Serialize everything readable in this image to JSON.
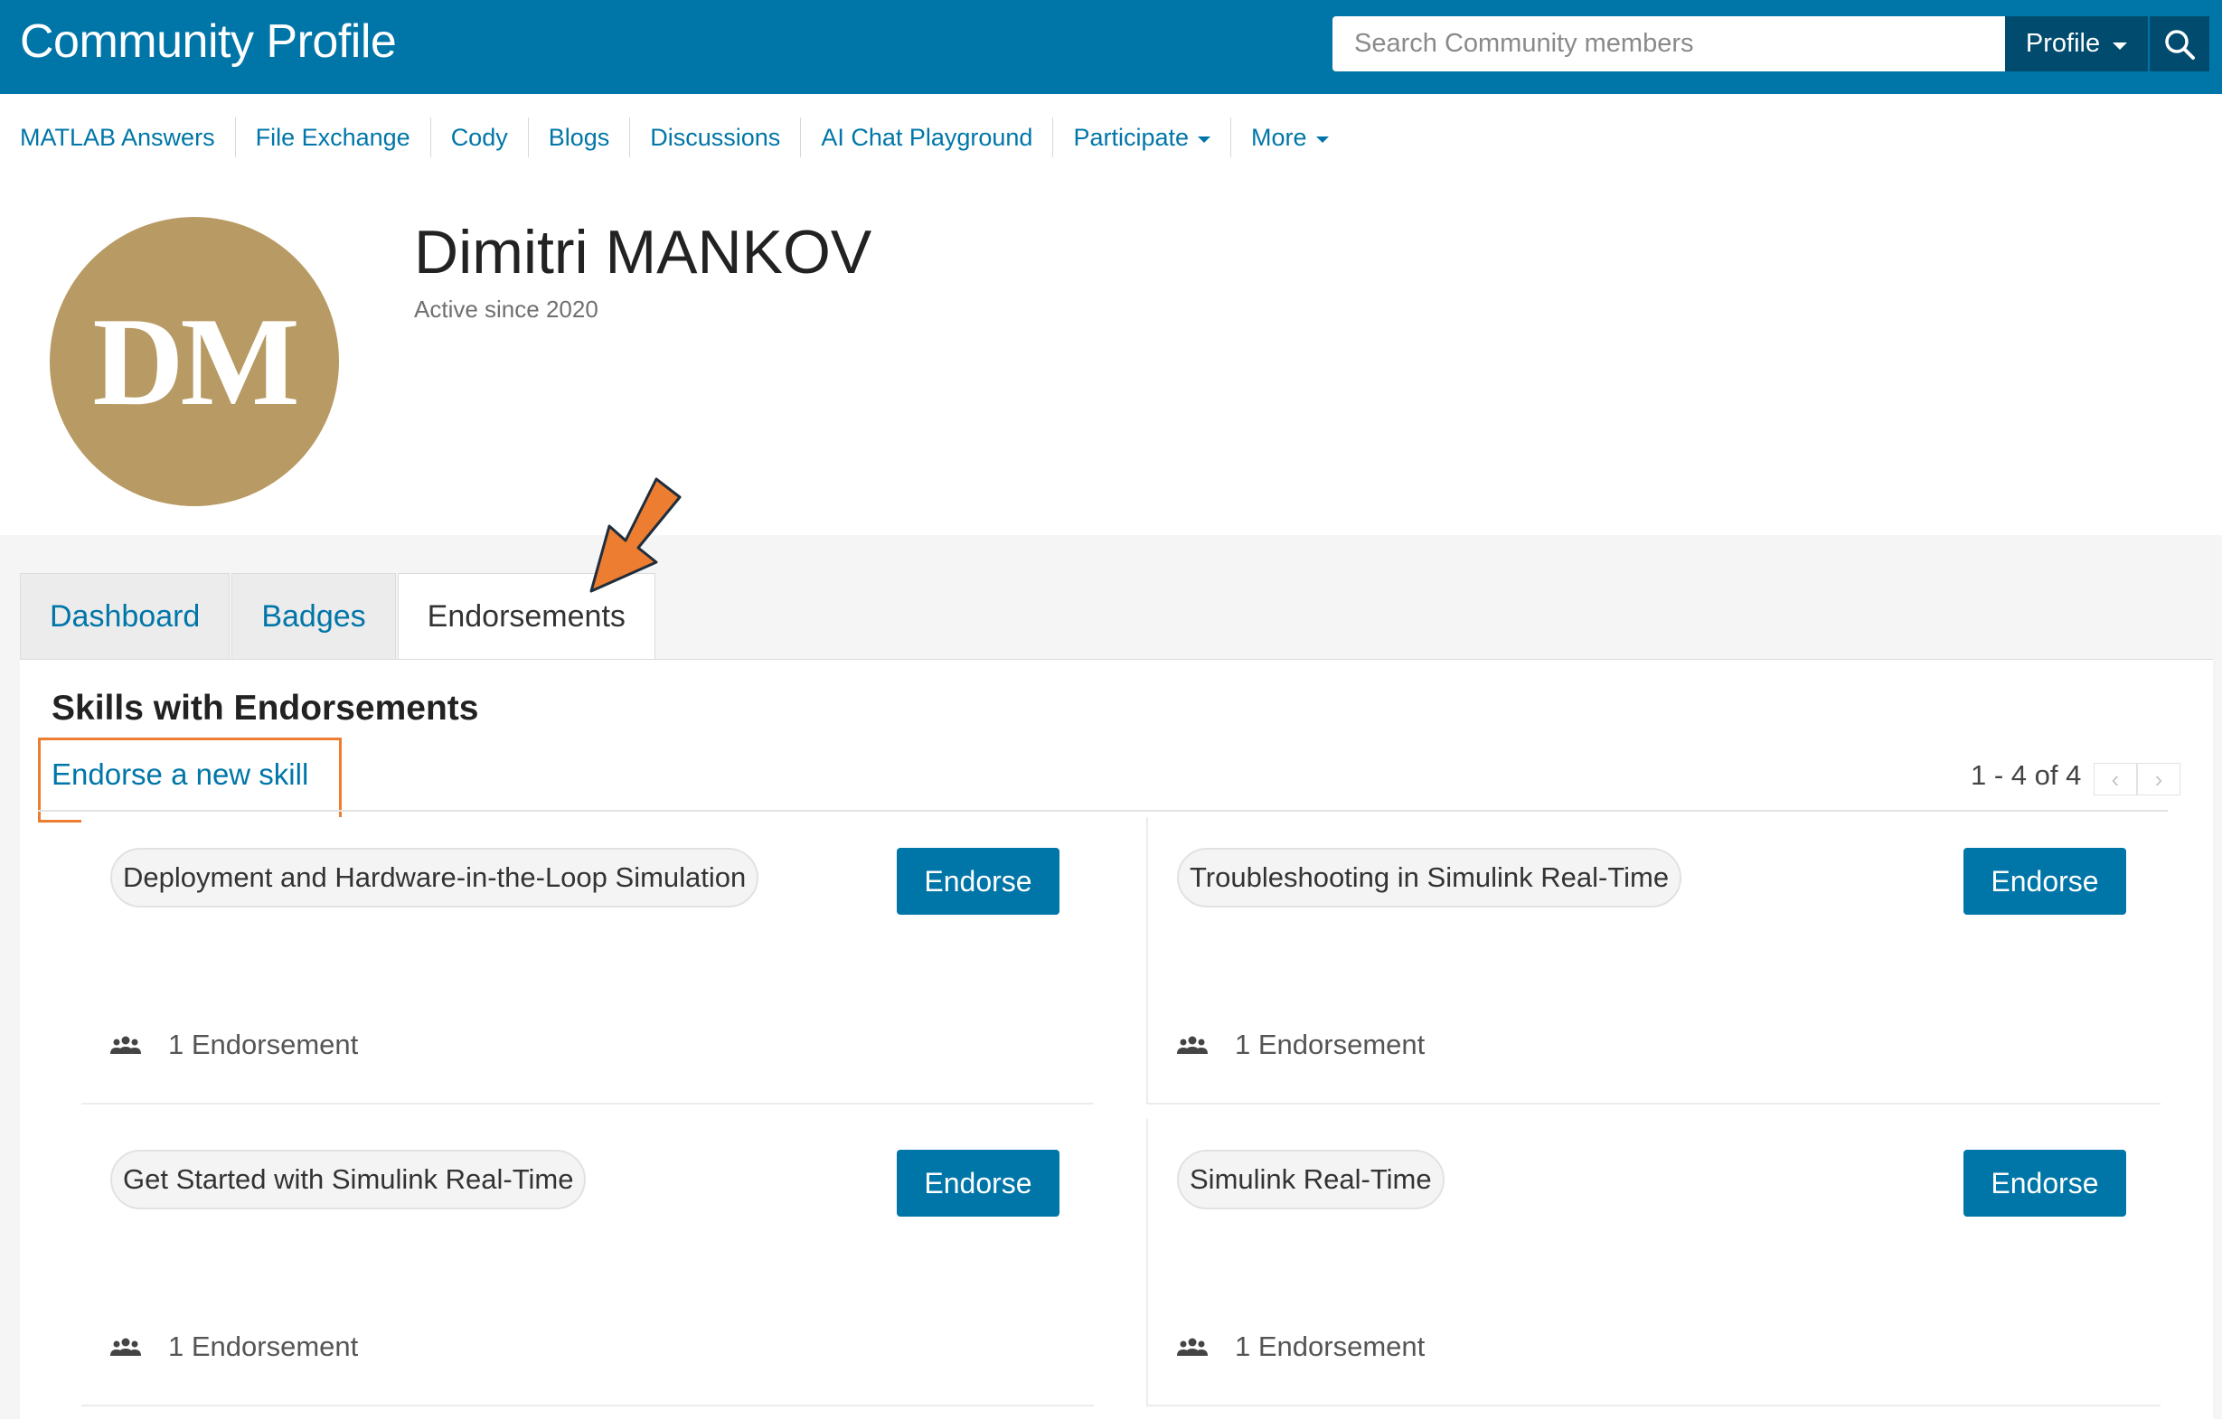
{
  "header": {
    "title": "Community Profile",
    "search_placeholder": "Search Community members",
    "profile_label": "Profile",
    "search_icon": "search-icon"
  },
  "nav": {
    "items": [
      {
        "label": "MATLAB Answers"
      },
      {
        "label": "File Exchange"
      },
      {
        "label": "Cody"
      },
      {
        "label": "Blogs"
      },
      {
        "label": "Discussions"
      },
      {
        "label": "AI Chat Playground"
      },
      {
        "label": "Participate"
      },
      {
        "label": "More"
      }
    ]
  },
  "profile": {
    "initials": "DM",
    "name": "Dimitri MANKOV",
    "active_since": "Active since 2020",
    "avatar_color": "#b89b64"
  },
  "tabs": [
    {
      "label": "Dashboard",
      "active": false
    },
    {
      "label": "Badges",
      "active": false
    },
    {
      "label": "Endorsements",
      "active": true
    }
  ],
  "endorsements": {
    "title": "Skills with Endorsements",
    "endorse_new_label": "Endorse a new skill",
    "pager_text": "1 - 4 of 4",
    "pager_prev": "‹",
    "pager_next": "›",
    "skills": [
      {
        "name": "Deployment and Hardware-in-the-Loop Simulation",
        "button": "Endorse",
        "count": "1 Endorsement"
      },
      {
        "name": "Troubleshooting in Simulink Real-Time",
        "button": "Endorse",
        "count": "1 Endorsement"
      },
      {
        "name": "Get Started with Simulink Real-Time",
        "button": "Endorse",
        "count": "1 Endorsement"
      },
      {
        "name": "Simulink Real-Time",
        "button": "Endorse",
        "count": "1 Endorsement"
      }
    ]
  },
  "colors": {
    "brand": "#0076a8",
    "brand_dark": "#004b6e",
    "annotation": "#ed7d31"
  }
}
